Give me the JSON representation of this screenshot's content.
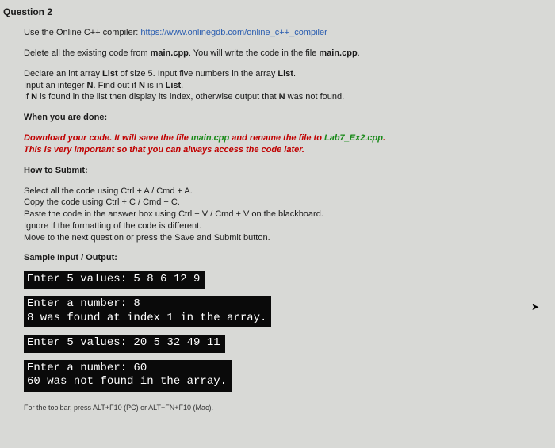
{
  "title": "Question 2",
  "intro": {
    "prefix": "Use the Online C++ compiler: ",
    "link_text": "https://www.onlinegdb.com/online_c++_compiler"
  },
  "delete_line": {
    "p1": "Delete all the existing code from ",
    "f1": "main.cpp",
    "p2": ". You will write the code in the file ",
    "f2": "main.cpp",
    "p3": "."
  },
  "task": {
    "l1a": "Declare an int array ",
    "l1b": "List",
    "l1c": " of size 5. Input five numbers in the array ",
    "l1d": "List",
    "l1e": ".",
    "l2a": "Input an integer ",
    "l2b": "N",
    "l2c": ". Find out if ",
    "l2d": "N",
    "l2e": " is in ",
    "l2f": "List",
    "l2g": ".",
    "l3a": "If ",
    "l3b": "N",
    "l3c": " is found in the list then display its index, otherwise output that ",
    "l3d": "N",
    "l3e": " was not found."
  },
  "done_heading": "When you are done:",
  "download": {
    "p1": "Download your code. It will save the file ",
    "p2": "main.cpp",
    "p3": " and rename the file to ",
    "p4": "Lab7_Ex2.cpp",
    "p5": ".",
    "line2": "This is very important so that you can always access the code later."
  },
  "submit_heading": "How to Submit:",
  "submit_steps": [
    "Select all the code using Ctrl + A / Cmd + A.",
    "Copy the code using Ctrl + C / Cmd + C.",
    "Paste the code in the answer box using Ctrl + V / Cmd + V on the blackboard.",
    "Ignore if the formatting of the code is different.",
    "Move to the next question or press the Save and Submit button."
  ],
  "sample_label": "Sample Input / Output:",
  "terminals": [
    "Enter 5 values: 5 8 6 12 9",
    "Enter a number: 8\n8 was found at index 1 in the array.",
    "Enter 5 values: 20 5 32 49 11",
    "Enter a number: 60\n60 was not found in the array."
  ],
  "footer": "For the toolbar, press ALT+F10 (PC) or ALT+FN+F10 (Mac)."
}
